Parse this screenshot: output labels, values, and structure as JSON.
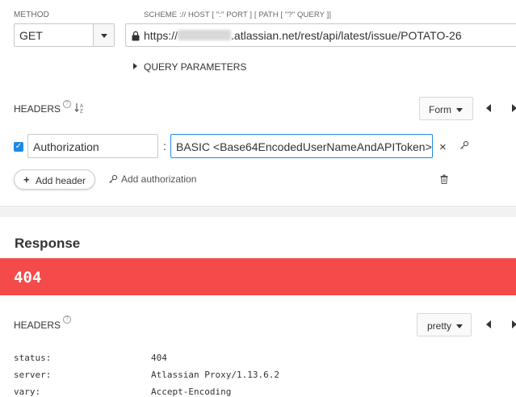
{
  "request": {
    "method_label": "METHOD",
    "method_value": "GET",
    "url_label": "SCHEME :// HOST [ \":\" PORT ] [ PATH [ \"?\" QUERY ]]",
    "url_prefix": "https://",
    "url_suffix": ".atlassian.net/rest/api/latest/issue/POTATO-26",
    "query_params_label": "QUERY PARAMETERS"
  },
  "request_headers": {
    "title": "HEADERS",
    "help": "?",
    "sort_glyph": "↓A̲Z",
    "view_mode": "Form",
    "rows": [
      {
        "enabled": true,
        "name": "Authorization",
        "value": "BASIC <Base64EncodedUserNameAndAPIToken>"
      }
    ],
    "add_header_label": "Add header",
    "add_authorization_label": "Add authorization"
  },
  "response": {
    "title": "Response",
    "status_code": "404",
    "status_color": "#f44a4a",
    "headers_title": "HEADERS",
    "view_mode": "pretty",
    "headers": [
      {
        "key": "status:",
        "value": "404"
      },
      {
        "key": "server:",
        "value": "Atlassian Proxy/1.13.6.2"
      },
      {
        "key": "vary:",
        "value": "Accept-Encoding"
      }
    ]
  },
  "icons": {
    "method_dropdown": "chevron-down-icon",
    "lock": "lock-icon",
    "expand": "caret-right-icon",
    "help": "help-circle-icon",
    "sort": "sort-alpha-icon",
    "nav_prev": "triangle-left-icon",
    "nav_next": "triangle-right-icon",
    "checkbox": "checkbox-checked-icon",
    "remove": "close-icon",
    "auth_key": "key-icon",
    "delete": "trash-icon",
    "add": "plus-icon"
  },
  "accent_color": "#1e88e5"
}
